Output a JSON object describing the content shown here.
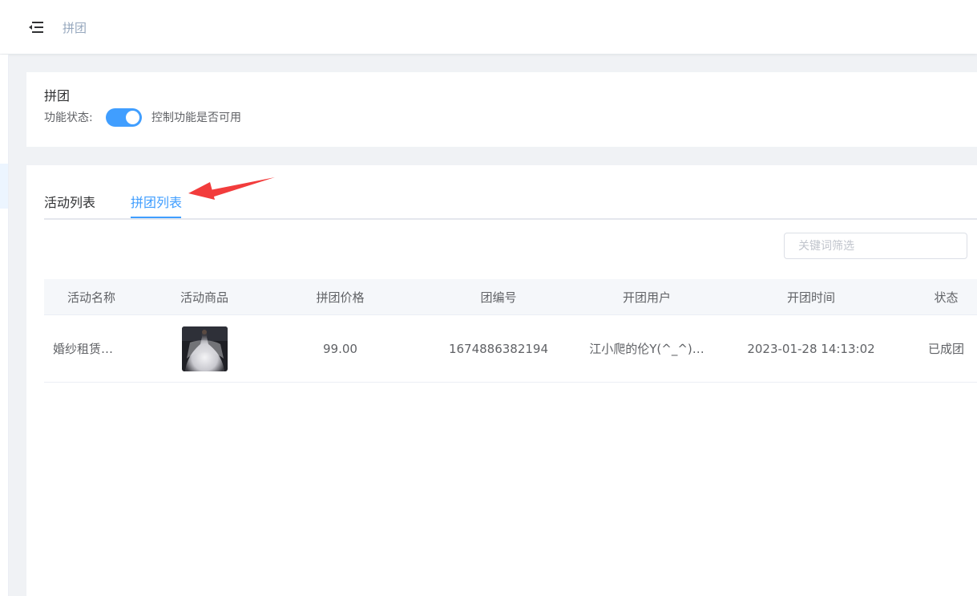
{
  "header": {
    "menu_icon": "menu-fold-icon",
    "breadcrumb": "拼团"
  },
  "settings": {
    "title": "拼团",
    "status_label": "功能状态:",
    "switch_on": true,
    "switch_desc": "控制功能是否可用"
  },
  "tabs": [
    {
      "label": "活动列表",
      "active": false
    },
    {
      "label": "拼团列表",
      "active": true
    }
  ],
  "search": {
    "placeholder": "关键词筛选",
    "value": ""
  },
  "table": {
    "columns": [
      "活动名称",
      "活动商品",
      "拼团价格",
      "团编号",
      "开团用户",
      "开团时间",
      "状态"
    ],
    "rows": [
      {
        "activity_name": "婚纱租赁…",
        "product_image": "wedding-dress-thumbnail",
        "price": "99.00",
        "group_no": "1674886382194",
        "user": "江小爬的伦Y(^_^)…",
        "time": "2023-01-28 14:13:02",
        "status": "已成团"
      }
    ]
  },
  "colors": {
    "primary": "#409eff",
    "annotation_arrow": "#f23c3c"
  }
}
